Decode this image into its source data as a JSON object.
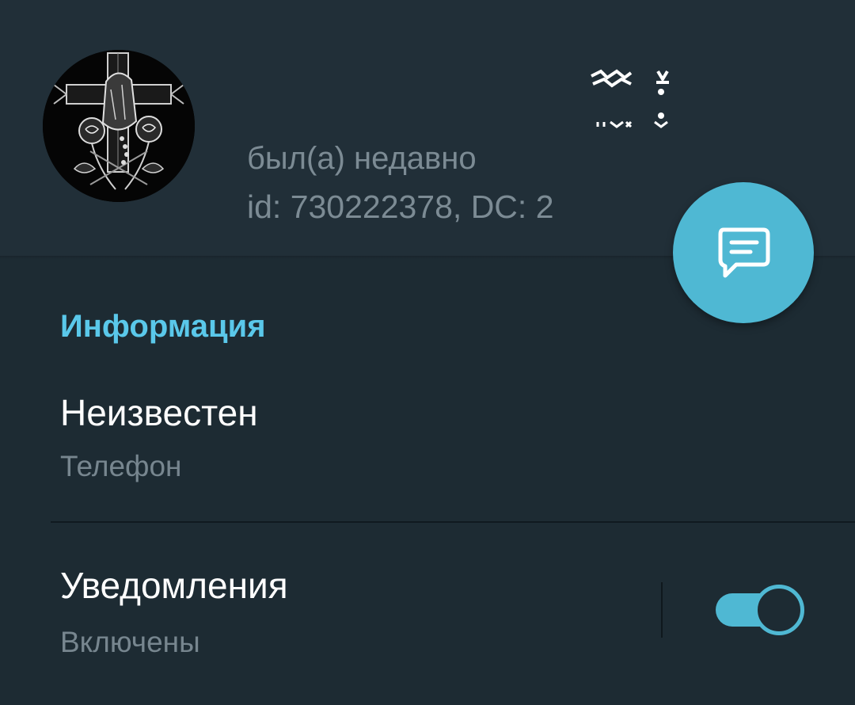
{
  "profile": {
    "status": "был(а) недавно",
    "id_line": "id: 730222378, DC: 2"
  },
  "fab": {
    "icon": "message-icon",
    "color": "#4fb8d3"
  },
  "info": {
    "section_title": "Информация",
    "phone_value": "Неизвестен",
    "phone_label": "Телефон"
  },
  "notifications": {
    "title": "Уведомления",
    "state": "Включены",
    "enabled": true
  },
  "colors": {
    "accent": "#5ac8ea",
    "header_bg": "#212f38",
    "body_bg": "#1d2b33"
  }
}
